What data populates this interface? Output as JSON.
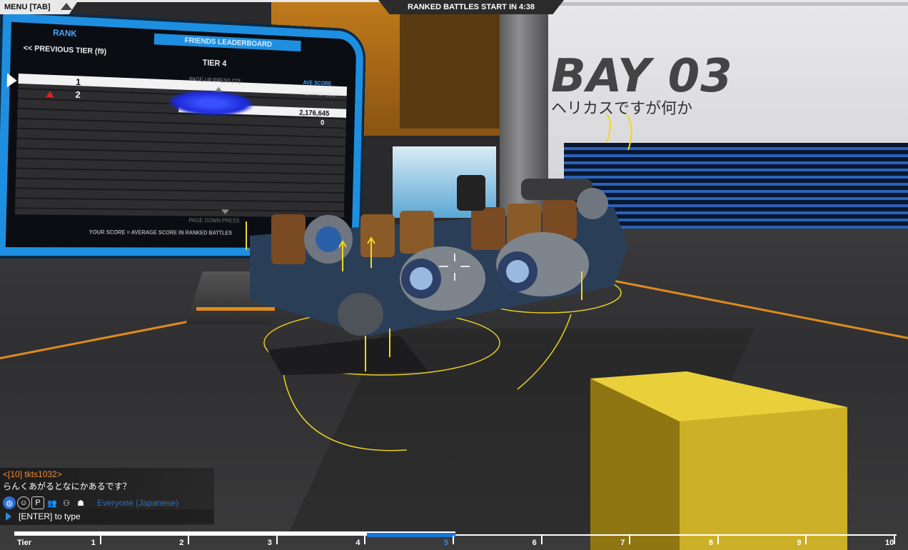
{
  "hud": {
    "menu_label": "MENU [TAB]",
    "timer_label": "RANKED BATTLES START IN 4:38"
  },
  "leaderboard": {
    "rank_label": "RANK",
    "title": "FRIENDS LEADERBOARD",
    "prev_tier": "<< PREVIOUS TIER (f9)",
    "tier": "TIER 4",
    "page_up": "PAGE UP PRESS  [??]",
    "ave_score_label": "AVE SCORE",
    "next_tier": "NEXT TIER (f10) >>",
    "rows": [
      {
        "rank": "1",
        "score": "2,176,645"
      },
      {
        "rank": "2",
        "score": "0"
      }
    ],
    "page_down": "PAGE DOWN PRESS",
    "footer": "YOUR SCORE = AVERAGE SCORE IN RANKED BATTLES"
  },
  "bay": {
    "title": "BAY 03",
    "subtitle": "ヘリカスですが何か"
  },
  "chat": {
    "user": "<[10] tkts1032>",
    "message": "らんくあがるとなにかあるです？",
    "channel": "Everyone (Japanese)",
    "input_hint": "[ENTER] to type",
    "icons": [
      "globe-icon",
      "person-icon",
      "p-icon",
      "group-icon",
      "friends-icon",
      "chat-person-icon"
    ]
  },
  "tier_bar": {
    "label": "Tier",
    "ticks": [
      "1",
      "2",
      "3",
      "4",
      "5",
      "6",
      "7",
      "8",
      "9",
      "10"
    ],
    "current": 5,
    "progress": 0.5
  },
  "colors": {
    "accent_blue": "#1e8fe0",
    "chat_user": "#f08a30",
    "gold": "#c9a820"
  }
}
